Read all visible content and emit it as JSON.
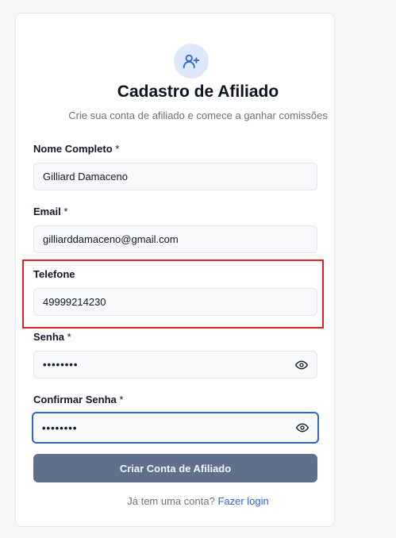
{
  "title": "Cadastro de Afiliado",
  "subtitle": "Crie sua conta de afiliado e comece a ganhar comissões",
  "fields": {
    "name": {
      "label": "Nome Completo",
      "required": "*",
      "value": "Gilliard Damaceno"
    },
    "email": {
      "label": "Email",
      "required": "*",
      "value": "gilliarddamaceno@gmail.com"
    },
    "phone": {
      "label": "Telefone",
      "value": "49999214230"
    },
    "password": {
      "label": "Senha",
      "required": "*",
      "value": "••••••••"
    },
    "confirm": {
      "label": "Confirmar Senha",
      "required": "*",
      "value": "••••••••"
    }
  },
  "submit_label": "Criar Conta de Afiliado",
  "login_prompt": "Já tem uma conta?",
  "login_link": "Fazer login",
  "icons": {
    "header": "user-plus-icon",
    "toggle": "eye-icon"
  },
  "colors": {
    "accent": "#2f64d6",
    "button": "#5f6f8c",
    "highlight": "#e01f26"
  }
}
